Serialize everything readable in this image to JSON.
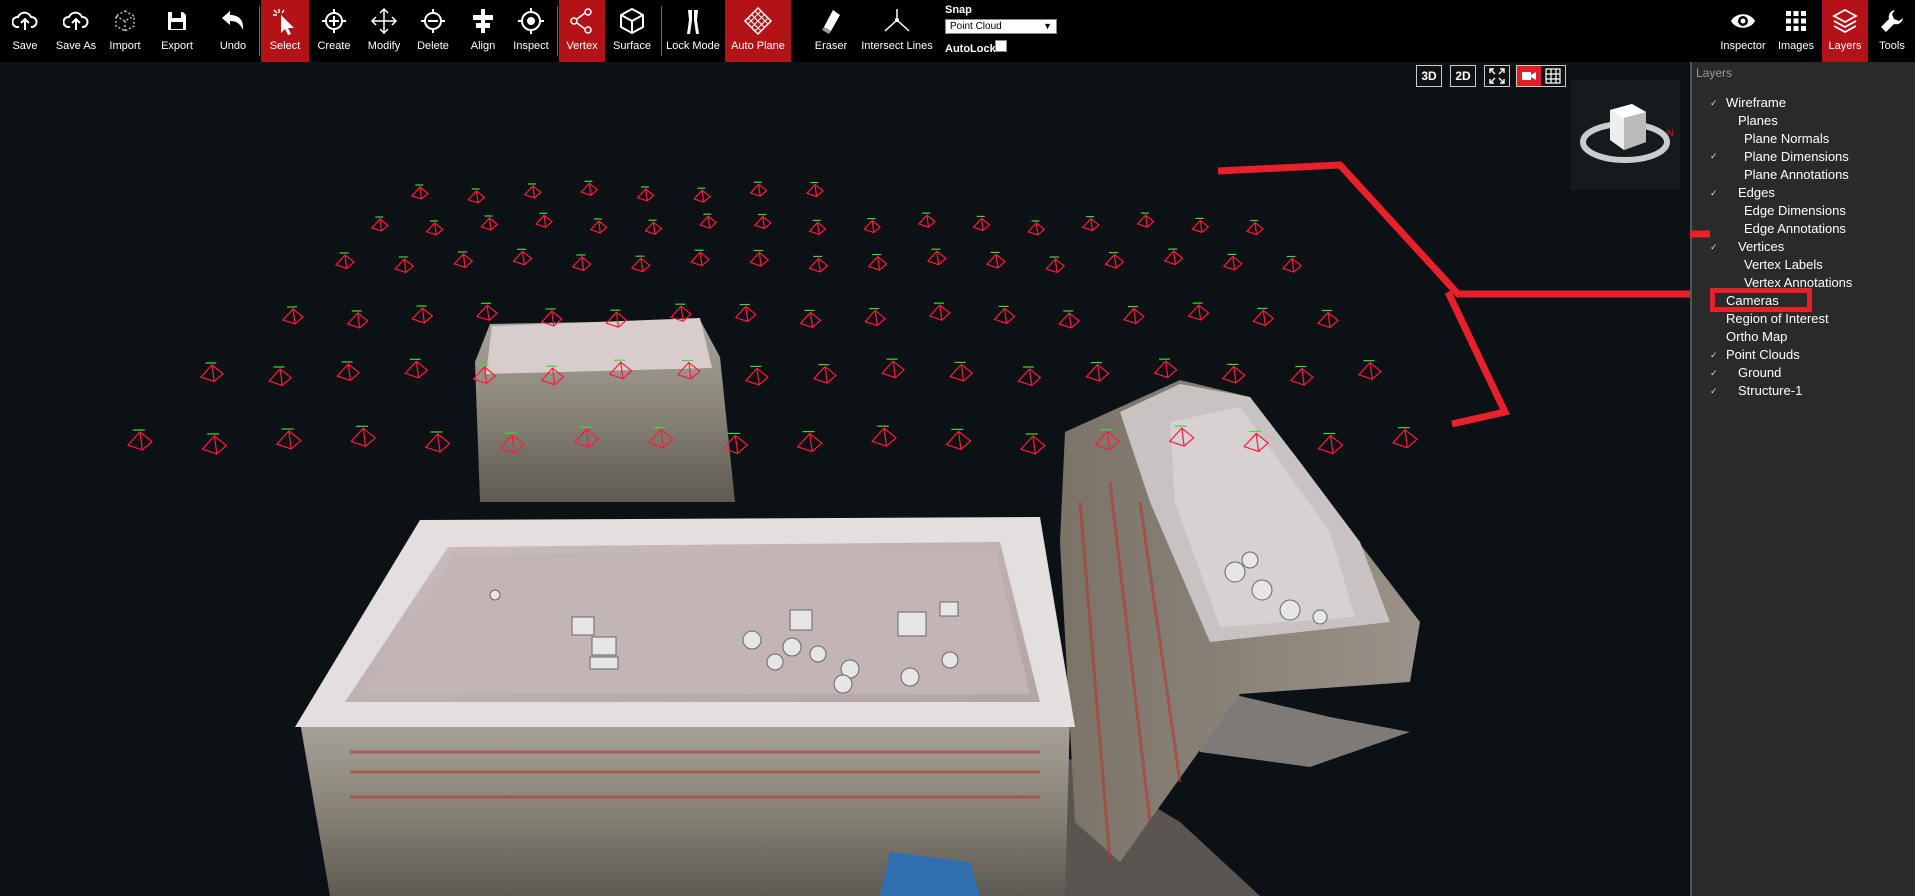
{
  "toolbar": {
    "save": "Save",
    "save_as": "Save As",
    "import": "Import",
    "export": "Export",
    "undo": "Undo",
    "select": "Select",
    "create": "Create",
    "modify": "Modify",
    "delete": "Delete",
    "align": "Align",
    "inspect": "Inspect",
    "vertex": "Vertex",
    "surface": "Surface",
    "lock_mode": "Lock Mode",
    "auto_plane": "Auto Plane",
    "eraser": "Eraser",
    "intersect_lines": "Intersect Lines",
    "snap_label": "Snap",
    "snap_value": "Point Cloud",
    "autolock_label": "AutoLock"
  },
  "right_toolbar": {
    "inspector": "Inspector",
    "images": "Images",
    "layers": "Layers",
    "tools": "Tools"
  },
  "view_buttons": {
    "three_d": "3D",
    "two_d": "2D"
  },
  "panel": {
    "title": "Layers",
    "layers": [
      {
        "label": "Wireframe",
        "checked": true
      },
      {
        "label": "Planes",
        "checked": false
      },
      {
        "label": "Plane Normals",
        "checked": false
      },
      {
        "label": "Plane Dimensions",
        "checked": false
      },
      {
        "label": "Plane Annotations",
        "checked": false
      },
      {
        "label": "Edges",
        "checked": true
      },
      {
        "label": "Edge Dimensions",
        "checked": false
      },
      {
        "label": "Edge Annotations",
        "checked": false
      },
      {
        "label": "Vertices",
        "checked": true
      },
      {
        "label": "Vertex Labels",
        "checked": false
      },
      {
        "label": "Vertex Annotations",
        "checked": false
      },
      {
        "label": "Cameras",
        "checked": false
      },
      {
        "label": "Region of Interest",
        "checked": false
      },
      {
        "label": "Ortho Map",
        "checked": false
      },
      {
        "label": "Point Clouds",
        "checked": true
      },
      {
        "label": "Ground",
        "checked": true
      },
      {
        "label": "Structure-1",
        "checked": true
      }
    ]
  },
  "colors": {
    "accent": "#b31217",
    "camera_marker": "#ff1a3a",
    "annotation": "#e8202a"
  }
}
